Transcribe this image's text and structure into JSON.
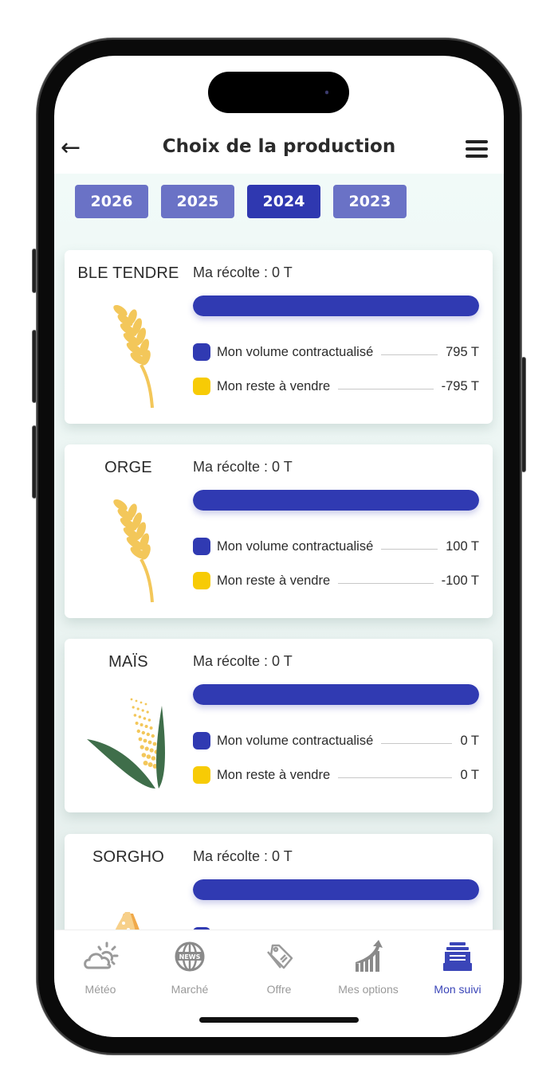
{
  "header": {
    "title": "Choix de la production",
    "back_icon": "arrow-left",
    "menu_icon": "hamburger"
  },
  "years": [
    {
      "label": "2026",
      "active": false
    },
    {
      "label": "2025",
      "active": false
    },
    {
      "label": "2024",
      "active": true
    },
    {
      "label": "2023",
      "active": false
    }
  ],
  "colors": {
    "primary": "#303ab2",
    "year_inactive": "#6a72c6",
    "remaining": "#f7cb05",
    "tab_active": "#3a45b8"
  },
  "crops": [
    {
      "name": "BLE TENDRE",
      "icon": "wheat-icon",
      "harvest": "Ma récolte : 0 T",
      "contracted_fraction": 1.0,
      "contracted_label": "Mon volume contractualisé",
      "contracted_value": "795 T",
      "remaining_label": "Mon reste à vendre",
      "remaining_value": "-795 T"
    },
    {
      "name": "ORGE",
      "icon": "barley-icon",
      "harvest": "Ma récolte : 0 T",
      "contracted_fraction": 1.0,
      "contracted_label": "Mon volume contractualisé",
      "contracted_value": "100 T",
      "remaining_label": "Mon reste à vendre",
      "remaining_value": "-100 T"
    },
    {
      "name": "MAÏS",
      "icon": "corn-icon",
      "harvest": "Ma récolte : 0 T",
      "contracted_fraction": 1.0,
      "contracted_label": "Mon volume contractualisé",
      "contracted_value": "0 T",
      "remaining_label": "Mon reste à vendre",
      "remaining_value": "0 T"
    },
    {
      "name": "SORGHO",
      "icon": "sorghum-icon",
      "harvest": "Ma récolte : 0 T",
      "contracted_fraction": 1.0
    }
  ],
  "tabs": [
    {
      "label": "Météo",
      "icon": "weather-icon",
      "active": false
    },
    {
      "label": "Marché",
      "icon": "news-globe-icon",
      "active": false
    },
    {
      "label": "Offre",
      "icon": "price-tag-icon",
      "active": false
    },
    {
      "label": "Mes options",
      "icon": "growth-chart-icon",
      "active": false
    },
    {
      "label": "Mon suivi",
      "icon": "tray-stack-icon",
      "active": true
    }
  ]
}
